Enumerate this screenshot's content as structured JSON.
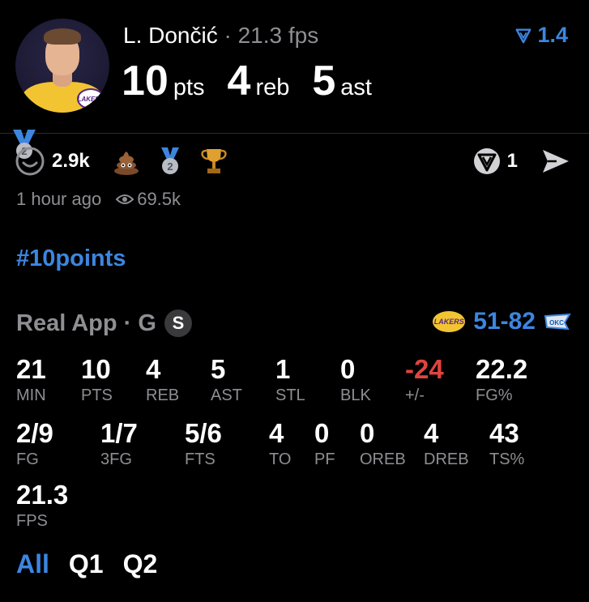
{
  "post": {
    "player_name": "L. Dončić",
    "separator": "·",
    "fps": "21.3 fps",
    "rank": "1.4",
    "line": [
      {
        "value": "10",
        "unit": "pts"
      },
      {
        "value": "4",
        "unit": "reb"
      },
      {
        "value": "5",
        "unit": "ast"
      }
    ],
    "avatar_team": "LAKERS"
  },
  "reactions": {
    "medal_number": "2",
    "count": "2.9k",
    "badge_number": "2",
    "share_count": "1"
  },
  "meta": {
    "time_ago": "1 hour ago",
    "views": "69.5k"
  },
  "hashtag": "#10points",
  "game": {
    "source": "Real App · G",
    "badge": "S",
    "score": "51-82",
    "home_logo_text": "LAKERS",
    "away_logo_text": "OKC"
  },
  "stats_row1": [
    {
      "value": "21",
      "label": "MIN"
    },
    {
      "value": "10",
      "label": "PTS"
    },
    {
      "value": "4",
      "label": "REB"
    },
    {
      "value": "5",
      "label": "AST"
    },
    {
      "value": "1",
      "label": "STL"
    },
    {
      "value": "0",
      "label": "BLK"
    },
    {
      "value": "-24",
      "label": "+/-"
    },
    {
      "value": "22.2",
      "label": "FG%"
    }
  ],
  "stats_row2": [
    {
      "value": "2/9",
      "label": "FG"
    },
    {
      "value": "1/7",
      "label": "3FG"
    },
    {
      "value": "5/6",
      "label": "FTS"
    },
    {
      "value": "4",
      "label": "TO"
    },
    {
      "value": "0",
      "label": "PF"
    },
    {
      "value": "0",
      "label": "OREB"
    },
    {
      "value": "4",
      "label": "DREB"
    },
    {
      "value": "43",
      "label": "TS%"
    }
  ],
  "stats_row3": [
    {
      "value": "21.3",
      "label": "FPS"
    }
  ],
  "tabs": [
    "All",
    "Q1",
    "Q2"
  ],
  "colors": {
    "accent": "#3c86e0",
    "negative": "#e0443e",
    "muted": "#8e8e93"
  }
}
